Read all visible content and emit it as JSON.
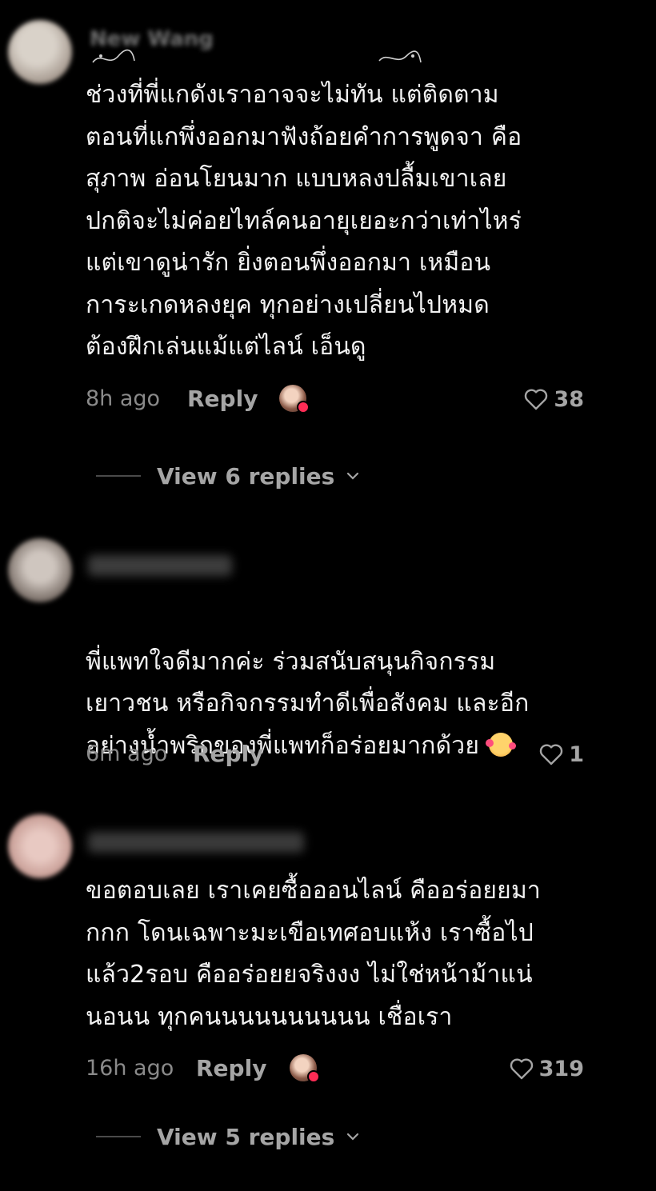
{
  "colors": {
    "background": "#000000",
    "text": "#f2f2f2",
    "muted": "#8a8a8a",
    "action": "#a5a5a5",
    "creator_badge": "#fe2c55"
  },
  "comments": [
    {
      "username": "New Wang",
      "text": "ช่วงที่พี่แกดังเราอาจจะไม่ทัน แต่ติดตาม\nตอนที่แกพึ่งออกมาฟังถ้อยคำการพูดจา คือ\nสุภาพ อ่อนโยนมาก แบบหลงปลื้มเขาเลย\nปกติจะไม่ค่อยไทล์คนอายุเยอะกว่าเท่าไหร่\nแต่เขาดูน่ารัก ยิ่งตอนพึ่งออกมา เหมือน\nการะเกดหลงยุค ทุกอย่างเปลี่ยนไปหมด\nต้องฝึกเล่นแม้แต่ไลน์ เอ็นดู",
      "time": "8h ago",
      "reply_label": "Reply",
      "liked_by_creator": true,
      "likes": "38",
      "view_replies": "View 6 replies"
    },
    {
      "username": "",
      "text": "พี่แพทใจดีมากค่ะ ร่วมสนับสนุนกิจกรรม\nเยาวชน หรือกิจกรรมทำดีเพื่อสังคม และอีก\nอย่างน้ำพริกของพี่แพทก็อร่อยมากด้วย",
      "emoji": "smiling-face-with-hearts",
      "time": "6m ago",
      "reply_label": "Reply",
      "liked_by_creator": false,
      "likes": "1"
    },
    {
      "username": "",
      "text": "ขอตอบเลย เราเคยซื้อออนไลน์ คืออร่อยยมา\nกกก โดนเฉพาะมะเขือเทศอบแห้ง เราซื้อไป\nแล้ว2รอบ คืออร่อยยจริงงง ไม่ใช่หน้าม้าแน่\nนอนน ทุกคนนนนนนนนนน เชื่อเรา",
      "time": "16h ago",
      "reply_label": "Reply",
      "liked_by_creator": true,
      "likes": "319",
      "view_replies": "View 5 replies"
    }
  ]
}
